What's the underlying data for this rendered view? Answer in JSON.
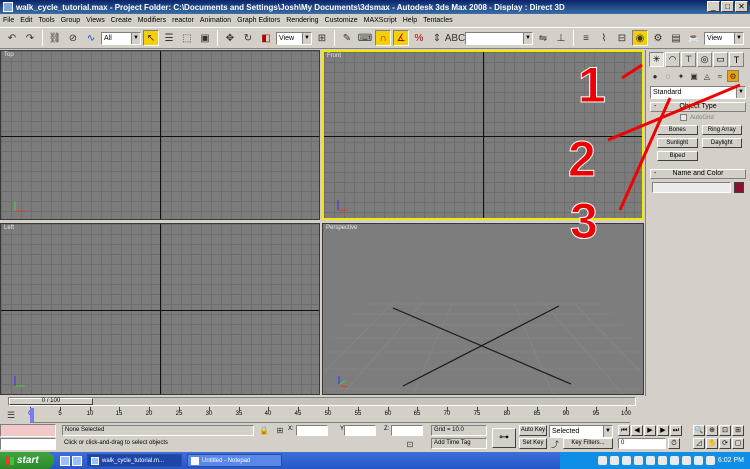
{
  "window": {
    "title": "walk_cycle_tutorial.max    - Project Folder: C:\\Documents and Settings\\Josh\\My Documents\\3dsmax    - Autodesk 3ds Max 2008    - Display : Direct 3D"
  },
  "menu": [
    "File",
    "Edit",
    "Tools",
    "Group",
    "Views",
    "Create",
    "Modifiers",
    "reactor",
    "Animation",
    "Graph Editors",
    "Rendering",
    "Customize",
    "MAXScript",
    "Help",
    "Tentacles"
  ],
  "toolbar": {
    "selection_filter": "All",
    "reference_coord": "View",
    "named_selection": "",
    "right_combo": "View"
  },
  "viewports": {
    "top": "Top",
    "front": "Front",
    "left": "Left",
    "perspective": "Perspective"
  },
  "command_panel": {
    "category_dropdown": "Standard",
    "object_type_title": "Object Type",
    "autogrid_label": "AutoGrid",
    "buttons": [
      "Bones",
      "Ring Array",
      "Sunlight",
      "Daylight",
      "Biped"
    ],
    "name_color_title": "Name and Color",
    "name_value": ""
  },
  "annotations": [
    "1",
    "2",
    "3"
  ],
  "timeline": {
    "slider_label": "0 / 100",
    "ticks": [
      0,
      5,
      10,
      15,
      20,
      25,
      30,
      35,
      40,
      45,
      50,
      55,
      60,
      65,
      70,
      75,
      80,
      85,
      90,
      95,
      100
    ],
    "current_frame": 0
  },
  "status": {
    "selection": "None Selected",
    "prompt": "Click or click-and-drag to select objects",
    "x_label": "X:",
    "y_label": "Y:",
    "z_label": "Z:",
    "grid": "Grid = 10.0",
    "auto_key": "Auto Key",
    "set_key": "Set Key",
    "key_mode": "Selected",
    "key_filters": "Key Filters...",
    "add_time_tag": "Add Time Tag",
    "frame_field": "0"
  },
  "taskbar": {
    "start": "start",
    "tasks": [
      "walk_cycle_tutorial.m...",
      "Untitled - Notepad"
    ],
    "clock": "6:02 PM"
  },
  "colors": {
    "active_viewport_border": "#f2e800",
    "annotation": "#ee0000",
    "object_color_swatch": "#8c1030"
  }
}
